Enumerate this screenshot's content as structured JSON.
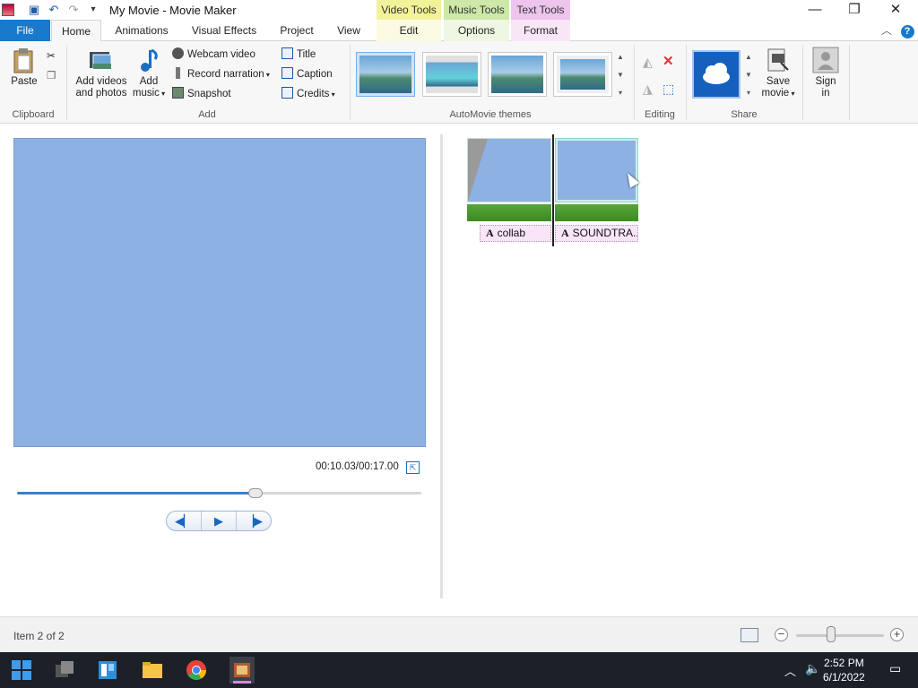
{
  "window": {
    "title": "My Movie - Movie Maker",
    "context_groups": [
      "Video Tools",
      "Music Tools",
      "Text Tools"
    ],
    "controls": {
      "minimize": "—",
      "maximize": "❐",
      "close": "✕"
    }
  },
  "tabs": {
    "file": "File",
    "home": "Home",
    "animations": "Animations",
    "visual_effects": "Visual Effects",
    "project": "Project",
    "view": "View",
    "edit": "Edit",
    "options": "Options",
    "format": "Format"
  },
  "ribbon": {
    "clipboard": {
      "paste": "Paste",
      "label": "Clipboard"
    },
    "add": {
      "add_videos_line1": "Add videos",
      "add_videos_line2": "and photos",
      "add_music_line1": "Add",
      "add_music_line2": "music",
      "webcam": "Webcam video",
      "narration": "Record narration",
      "snapshot": "Snapshot",
      "title": "Title",
      "caption": "Caption",
      "credits": "Credits",
      "label": "Add"
    },
    "themes": {
      "label": "AutoMovie themes"
    },
    "editing": {
      "label": "Editing"
    },
    "share": {
      "save_line1": "Save",
      "save_line2": "movie",
      "sign_line1": "Sign",
      "sign_line2": "in",
      "label": "Share"
    }
  },
  "preview": {
    "time": "00:10.03/00:17.00",
    "progress": 0.59
  },
  "storyboard": {
    "captions": [
      "collab",
      "SOUNDTRA..."
    ]
  },
  "status": {
    "item_text": "Item 2 of 2",
    "zoom_level": 0.4
  },
  "taskbar": {
    "time": "2:52 PM",
    "date": "6/1/2022"
  },
  "colors": {
    "file_tab": "#1979ca",
    "video_tools": "#f2f29a",
    "music_tools": "#cde8a8",
    "text_tools": "#ecc4ec",
    "preview_bg": "#8eb1e4"
  }
}
